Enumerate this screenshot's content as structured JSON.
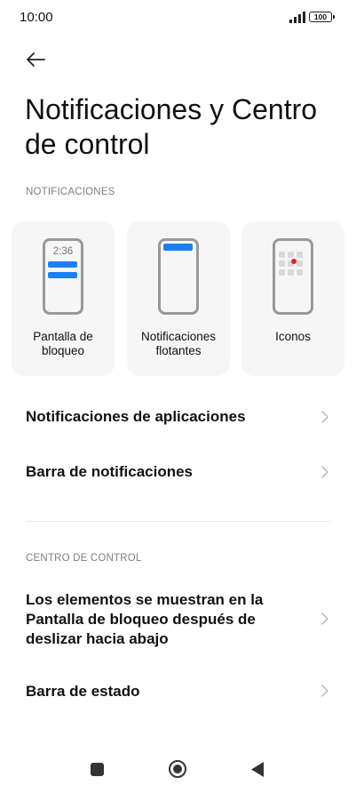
{
  "status_bar": {
    "time": "10:00",
    "battery": "100",
    "icons": [
      "signal-icon",
      "battery-icon"
    ]
  },
  "header": {
    "back_icon": "arrow-left-icon",
    "title": "Notificaciones y Centro de control"
  },
  "notifications_section": {
    "header": "NOTIFICACIONES",
    "cards": [
      {
        "label": "Pantalla de bloqueo",
        "preview_time": "2:36"
      },
      {
        "label": "Notificaciones flotantes"
      },
      {
        "label": "Iconos"
      }
    ],
    "items": [
      {
        "label": "Notificaciones de aplicaciones"
      },
      {
        "label": "Barra de notificaciones"
      }
    ]
  },
  "control_center_section": {
    "header": "CENTRO DE CONTROL",
    "items": [
      {
        "label": "Los elementos se muestran en la Pantalla de bloqueo después de deslizar hacia abajo"
      },
      {
        "label": "Barra de estado"
      }
    ]
  },
  "nav_bar": {
    "icons": [
      "recents-square-icon",
      "home-circle-icon",
      "back-triangle-icon"
    ]
  },
  "colors": {
    "accent": "#1c7ff2",
    "badge_dot": "#e8231f",
    "card_bg": "#f6f6f6",
    "section_header": "#7a7f87"
  }
}
